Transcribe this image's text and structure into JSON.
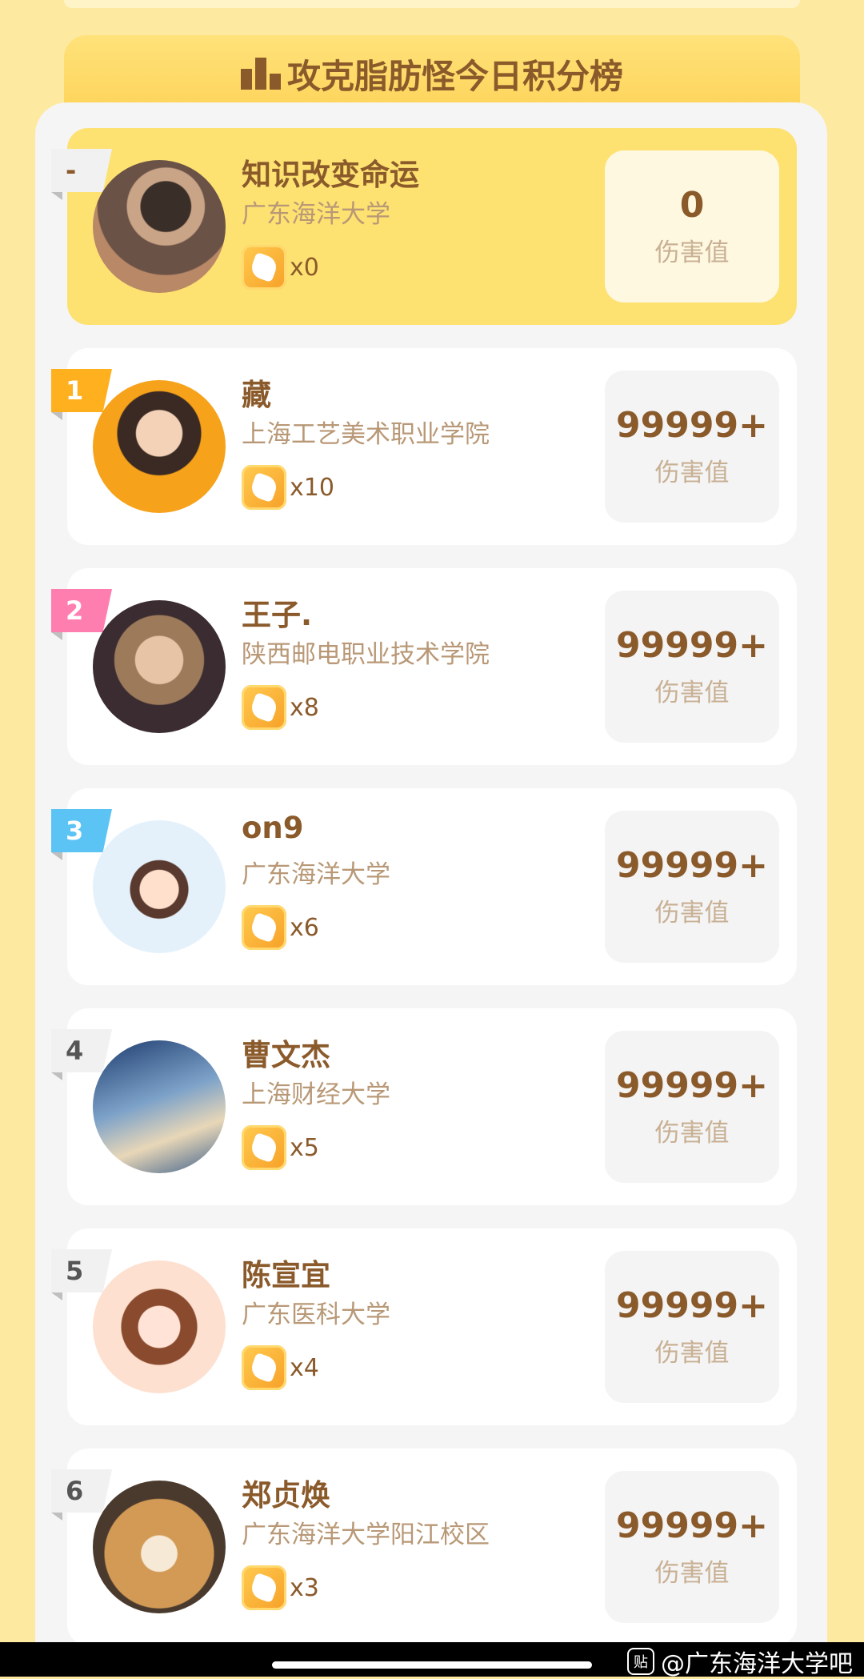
{
  "header": {
    "title": "攻克脂肪怪今日积分榜"
  },
  "score_label": "伤害值",
  "self_row": {
    "rank": "-",
    "name": "知识改变命运",
    "school": "广东海洋大学",
    "badge_count": "x0",
    "score": "0"
  },
  "rows": [
    {
      "rank": "1",
      "name": "藏",
      "school": "上海工艺美术职业学院",
      "badge_count": "x10",
      "score": "99999+"
    },
    {
      "rank": "2",
      "name": "王子.",
      "school": "陕西邮电职业技术学院",
      "badge_count": "x8",
      "score": "99999+"
    },
    {
      "rank": "3",
      "name": "on9",
      "school": "广东海洋大学",
      "badge_count": "x6",
      "score": "99999+"
    },
    {
      "rank": "4",
      "name": "曹文杰",
      "school": "上海财经大学",
      "badge_count": "x5",
      "score": "99999+"
    },
    {
      "rank": "5",
      "name": "陈宣宜",
      "school": "广东医科大学",
      "badge_count": "x4",
      "score": "99999+"
    },
    {
      "rank": "6",
      "name": "郑贞焕",
      "school": "广东海洋大学阳江校区",
      "badge_count": "x3",
      "score": "99999+"
    }
  ],
  "colors": {
    "rank1": "#ffb01f",
    "rank2": "#ff7eb0",
    "rank3": "#5cc4f5",
    "rank_other": "#f1f1f1"
  },
  "watermark": {
    "logo": "贴",
    "text": "@广东海洋大学吧"
  }
}
